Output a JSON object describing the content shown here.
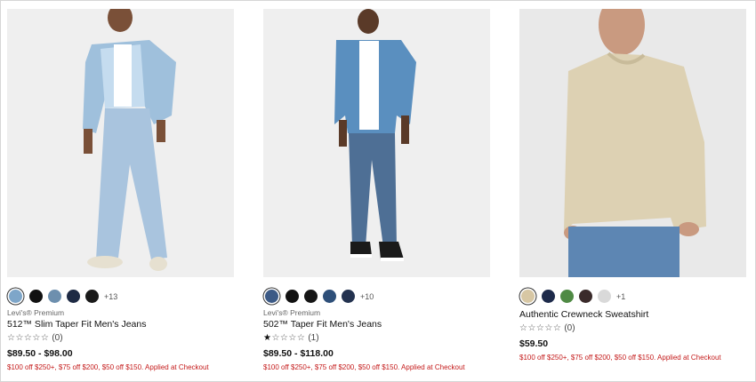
{
  "products": [
    {
      "brand": "Levi's® Premium",
      "name": "512™ Slim Taper Fit Men's Jeans",
      "stars": "☆☆☆☆☆",
      "stars_on": "",
      "review_count": "(0)",
      "price": "$89.50 - $98.00",
      "promo": "$100 off $250+, $75 off $200, $50 off $150. Applied at Checkout",
      "more_colors": "+13",
      "swatch_colors": [
        "#7ea6c9",
        "#111111",
        "#6d8fae",
        "#1e2a44",
        "#1a1a1a"
      ]
    },
    {
      "brand": "Levi's® Premium",
      "name": "502™ Taper Fit Men's Jeans",
      "stars": "☆☆☆☆",
      "stars_on": "★",
      "review_count": "(1)",
      "price": "$89.50 - $118.00",
      "promo": "$100 off $250+, $75 off $200, $50 off $150. Applied at Checkout",
      "more_colors": "+10",
      "swatch_colors": [
        "#3c5a86",
        "#111111",
        "#151515",
        "#2e4f79",
        "#23324f"
      ]
    },
    {
      "brand": "",
      "name": "Authentic Crewneck Sweatshirt",
      "stars": "☆☆☆☆☆",
      "stars_on": "",
      "review_count": "(0)",
      "price": "$59.50",
      "promo": "$100 off $250+, $75 off $200, $50 off $150. Applied at Checkout",
      "more_colors": "+1",
      "swatch_colors": [
        "#d7c7a4",
        "#1d2a4a",
        "#4f8a44",
        "#3a2a2a",
        "#d9d9d9"
      ]
    }
  ],
  "colors": {
    "promo_red": "#c41a1a",
    "price_text": "#111111"
  }
}
